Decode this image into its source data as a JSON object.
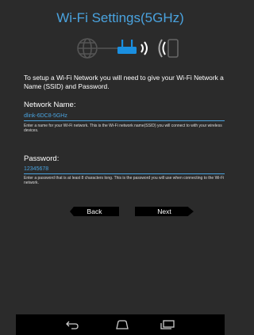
{
  "title": "Wi-Fi Settings(5GHz)",
  "intro": "To setup a Wi-Fi Network you will need to give your Wi-Fi Network a Name (SSID) and Password.",
  "network_name": {
    "label": "Network Name:",
    "value": "dlink-6DC8-5GHz",
    "help": "Enter a name for your Wi-Fi network. This is the Wi-Fi network name(SSID) you will connect to with your wireless devices."
  },
  "password": {
    "label": "Password:",
    "value": "12345678",
    "help": "Enter a password that is at least 8 characters long. This is the password you will use when connecting to the Wi-Fi network."
  },
  "buttons": {
    "back": "Back",
    "next": "Next"
  },
  "icons": {
    "diagram": [
      "globe-icon",
      "router-icon",
      "wifi-signal-icon",
      "phone-icon"
    ],
    "system_nav": [
      "back-nav-icon",
      "home-nav-icon",
      "recents-nav-icon"
    ]
  },
  "colors": {
    "accent": "#4aa3df",
    "background": "#2b2b2b"
  }
}
